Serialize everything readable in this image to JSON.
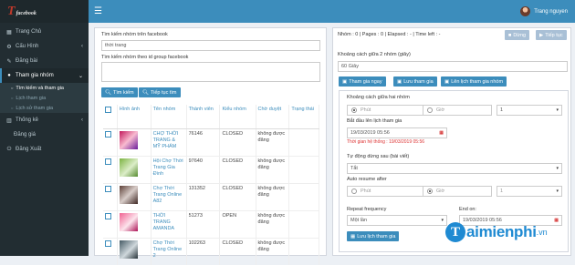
{
  "brand": {
    "logo_text": "T",
    "logo_sub": "facebook"
  },
  "topbar": {
    "user_name": "Trang nguyen"
  },
  "sidebar": {
    "items": [
      {
        "label": "Trang Chủ",
        "icon": "dashboard-icon"
      },
      {
        "label": "Cấu Hình",
        "icon": "gear-icon"
      },
      {
        "label": "Đăng bài",
        "icon": "pencil-icon"
      },
      {
        "label": "Tham gia nhóm",
        "icon": "group-icon"
      }
    ],
    "subitems": [
      "Tìm kiếm và tham gia",
      "Lịch tham gia",
      "Lịch sử tham gia"
    ],
    "stats": "Thống kê",
    "rate": "Đăng giá",
    "logout": "Đăng Xuất"
  },
  "left": {
    "search_label": "Tìm kiếm nhóm trên facebook",
    "search_value": "thời trang",
    "id_label": "Tìm kiếm nhóm theo id group facebook",
    "id_value": "",
    "search_button": "Tìm kiếm",
    "continue_button": "Tiếp tục tìm"
  },
  "table": {
    "headers": [
      "Hình ảnh",
      "Tên nhóm",
      "Thành viên",
      "Kiểu nhóm",
      "Chờ duyệt",
      "Trạng thái"
    ],
    "rows": [
      {
        "name": "CHỢ THỜI TRANG & MỸ PHẨM",
        "members": "76146",
        "type": "CLOSED",
        "approval": "không được đăng",
        "status": ""
      },
      {
        "name": "Hội Chợ Thời Trang Gia Đình",
        "members": "97640",
        "type": "CLOSED",
        "approval": "không được đăng",
        "status": ""
      },
      {
        "name": "Chợ Thời Trang Online A82",
        "members": "131352",
        "type": "CLOSED",
        "approval": "không được đăng",
        "status": ""
      },
      {
        "name": "THỜI TRANG AMANDA",
        "members": "51273",
        "type": "OPEN",
        "approval": "không được đăng",
        "status": ""
      },
      {
        "name": "Chợ Thời Trang Online 2",
        "members": "102263",
        "type": "CLOSED",
        "approval": "không được đăng",
        "status": ""
      }
    ]
  },
  "right": {
    "status_line": "Nhóm : 0 | Pages : 0 | Elapsed : - | Time left : -",
    "stop_button": "Dừng",
    "continue_button": "Tiếp tục",
    "interval_label": "Khoảng cách giữa 2 nhóm (giây)",
    "interval_value": "60 Giây",
    "join_now_button": "Tham gia ngay",
    "save_button": "Lưu tham gia",
    "schedule_button": "Lên lịch tham gia nhóm",
    "between_label": "Khoảng cách giữa hai nhóm",
    "minute_placeholder": "Phút",
    "hour_placeholder": "Giờ",
    "between_count": "1",
    "start_label": "Bắt đầu lên lịch tham gia",
    "start_value": "19/03/2019 05:56",
    "system_time": "Thời gian hệ thống : 19/03/2019 05:56",
    "autostop_label": "Tự động dừng sau (bài viết)",
    "autostop_value": "Tắt",
    "resume_label": "Auto resume after",
    "resume_minute": "Phút",
    "resume_hour": "Giờ",
    "resume_count": "1",
    "repeat_label": "Repeat frequency",
    "repeat_value": "Một lần",
    "end_label": "End on:",
    "end_value": "19/03/2019 05:56",
    "save_schedule_button": "Lưu lịch tham gia"
  },
  "watermark": {
    "text": "aimienphi",
    "suffix": ".vn"
  }
}
